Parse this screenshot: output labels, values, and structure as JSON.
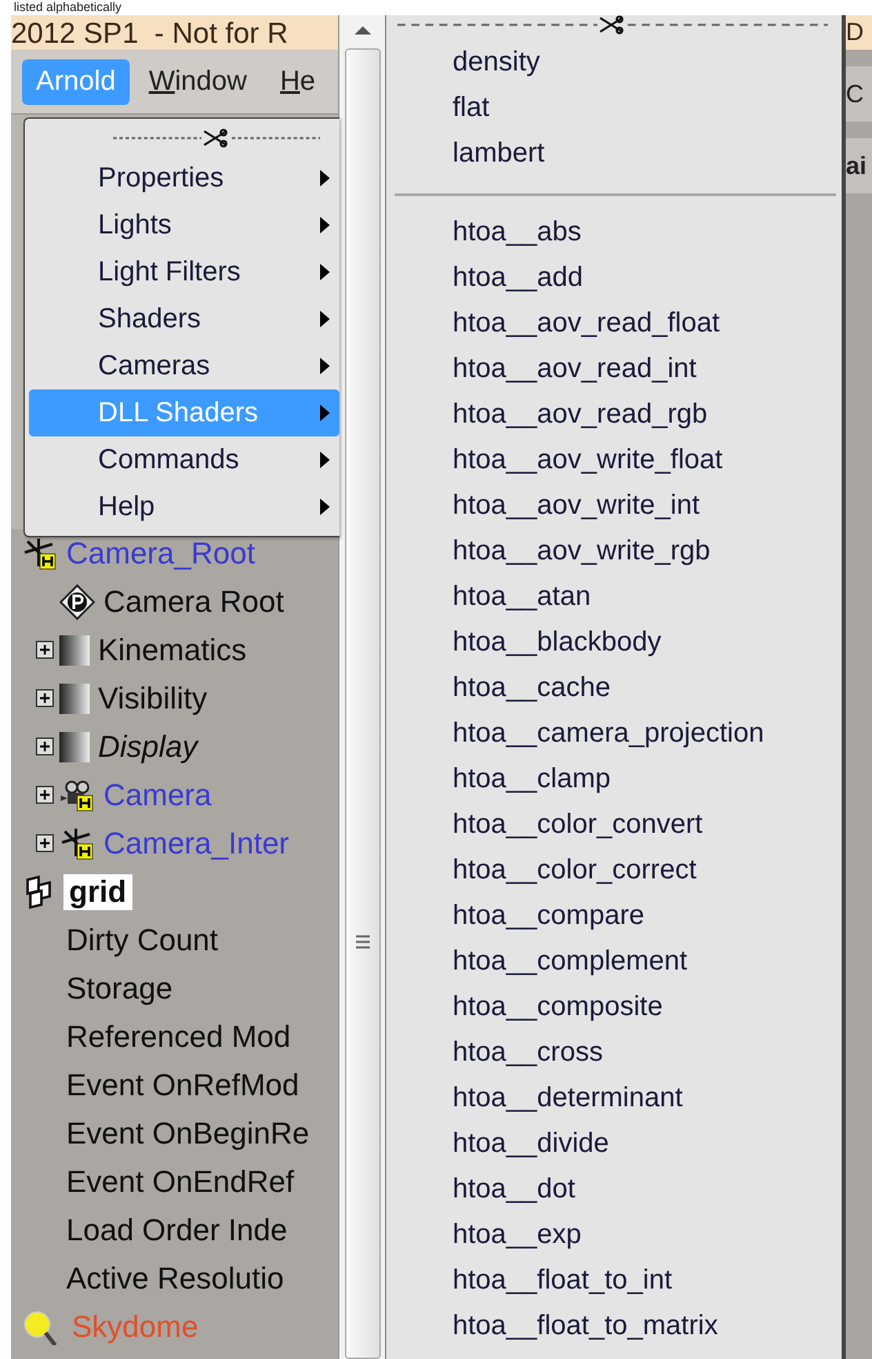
{
  "caption": "listed alphabetically",
  "title_bar": {
    "title": "2012 SP1  - Not for R"
  },
  "menu_bar": [
    {
      "label": "Arnold",
      "selected": true,
      "mnemonic": false
    },
    {
      "label": "Window",
      "selected": false,
      "mnemonic": true
    },
    {
      "label": "He",
      "selected": false,
      "mnemonic": true
    }
  ],
  "arnold_menu": [
    {
      "label": "Properties",
      "selected": false
    },
    {
      "label": "Lights",
      "selected": false
    },
    {
      "label": "Light Filters",
      "selected": false
    },
    {
      "label": "Shaders",
      "selected": false
    },
    {
      "label": "Cameras",
      "selected": false
    },
    {
      "label": "DLL Shaders",
      "selected": true
    },
    {
      "label": "Commands",
      "selected": false
    },
    {
      "label": "Help",
      "selected": false
    }
  ],
  "tree": [
    {
      "label": "Camera_Root",
      "kind": "null",
      "color": "#3a3ad0",
      "italic": false,
      "selected": false,
      "expander": false,
      "children": [
        {
          "label": "Camera Root",
          "kind": "primitive",
          "color": "#101010",
          "italic": false,
          "selected": false,
          "expander": false
        },
        {
          "label": "Kinematics",
          "kind": "group",
          "color": "#101010",
          "italic": false,
          "selected": false,
          "expander": true
        },
        {
          "label": "Visibility",
          "kind": "group",
          "color": "#101010",
          "italic": false,
          "selected": false,
          "expander": true
        },
        {
          "label": "Display",
          "kind": "group",
          "color": "#101010",
          "italic": true,
          "selected": false,
          "expander": true
        },
        {
          "label": "Camera",
          "kind": "camera",
          "color": "#3a3ad0",
          "italic": false,
          "selected": false,
          "expander": true
        },
        {
          "label": "Camera_Inter",
          "kind": "null",
          "color": "#3a3ad0",
          "italic": false,
          "selected": false,
          "expander": true
        }
      ]
    },
    {
      "label": "grid",
      "kind": "grid",
      "color": "#101010",
      "italic": false,
      "selected": true,
      "expander": false
    },
    {
      "label": "Dirty Count",
      "kind": "param",
      "color": "#101010",
      "italic": false,
      "selected": false,
      "expander": false
    },
    {
      "label": "Storage",
      "kind": "param",
      "color": "#101010",
      "italic": false,
      "selected": false,
      "expander": false
    },
    {
      "label": "Referenced Mod",
      "kind": "param",
      "color": "#101010",
      "italic": false,
      "selected": false,
      "expander": false
    },
    {
      "label": "Event OnRefMod",
      "kind": "param",
      "color": "#101010",
      "italic": false,
      "selected": false,
      "expander": false
    },
    {
      "label": "Event OnBeginRe",
      "kind": "param",
      "color": "#101010",
      "italic": false,
      "selected": false,
      "expander": false
    },
    {
      "label": "Event OnEndRef",
      "kind": "param",
      "color": "#101010",
      "italic": false,
      "selected": false,
      "expander": false
    },
    {
      "label": "Load Order Inde",
      "kind": "param",
      "color": "#101010",
      "italic": false,
      "selected": false,
      "expander": false
    },
    {
      "label": "Active Resolutio",
      "kind": "param",
      "color": "#101010",
      "italic": false,
      "selected": false,
      "expander": false
    },
    {
      "label": "Skydome",
      "kind": "light",
      "color": "#e0502a",
      "italic": false,
      "selected": false,
      "expander": false
    }
  ],
  "dll_shaders_menu": {
    "builtin": [
      "density",
      "flat",
      "lambert"
    ],
    "htoa": [
      "htoa__abs",
      "htoa__add",
      "htoa__aov_read_float",
      "htoa__aov_read_int",
      "htoa__aov_read_rgb",
      "htoa__aov_write_float",
      "htoa__aov_write_int",
      "htoa__aov_write_rgb",
      "htoa__atan",
      "htoa__blackbody",
      "htoa__cache",
      "htoa__camera_projection",
      "htoa__clamp",
      "htoa__color_convert",
      "htoa__color_correct",
      "htoa__compare",
      "htoa__complement",
      "htoa__composite",
      "htoa__cross",
      "htoa__determinant",
      "htoa__divide",
      "htoa__dot",
      "htoa__exp",
      "htoa__float_to_int",
      "htoa__float_to_matrix"
    ]
  },
  "background_fragments": [
    {
      "text": "D",
      "kind": "title"
    },
    {
      "text": "C",
      "kind": "label"
    },
    {
      "text": "ai",
      "kind": "label"
    }
  ]
}
